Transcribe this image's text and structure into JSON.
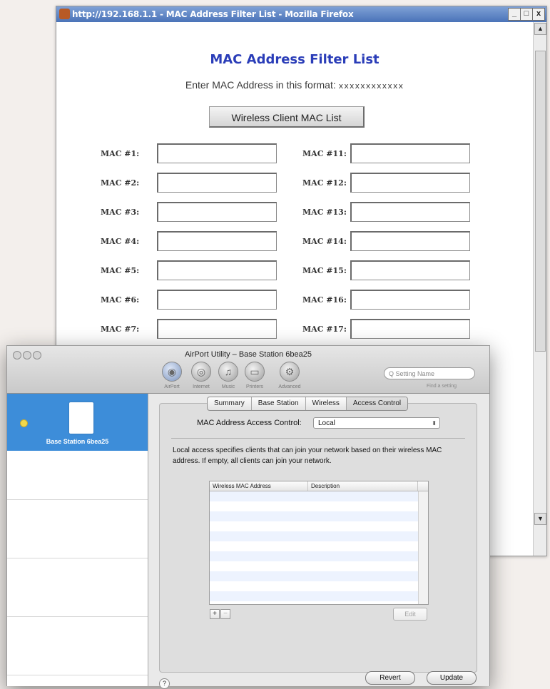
{
  "firefox": {
    "title": "http://192.168.1.1 - MAC Address Filter List - Mozilla Firefox",
    "win_buttons": [
      "_",
      "□",
      "x"
    ],
    "page_title": "MAC Address Filter List",
    "format_label": "Enter MAC Address in this format:",
    "format_value": "xxxxxxxxxxxx",
    "wireless_button": "Wireless Client MAC List",
    "mac_left": [
      "MAC #1:",
      "MAC #2:",
      "MAC #3:",
      "MAC #4:",
      "MAC #5:",
      "MAC #6:",
      "MAC #7:"
    ],
    "mac_right": [
      "MAC #11:",
      "MAC #12:",
      "MAC #13:",
      "MAC #14:",
      "MAC #15:",
      "MAC #16:",
      "MAC #17:"
    ],
    "scroll_up": "▲",
    "scroll_down": "▼"
  },
  "airport": {
    "title": "AirPort Utility – Base Station 6bea25",
    "toolbar": {
      "airport": "AirPort",
      "internet": "Internet",
      "music": "Music",
      "printers": "Printers",
      "advanced": "Advanced"
    },
    "search_placeholder": "Q Setting Name",
    "search_hint": "Find a setting",
    "sidebar_item": "Base Station 6bea25",
    "tabs": [
      "Summary",
      "Base Station",
      "Wireless",
      "Access Control"
    ],
    "mac_access_label": "MAC Address Access Control:",
    "mac_access_value": "Local",
    "description": "Local access specifies clients that can join your network based on their wireless MAC address. If empty, all clients can join your network.",
    "table_headers": [
      "Wireless MAC Address",
      "Description"
    ],
    "add_label": "+",
    "remove_label": "−",
    "edit_label": "Edit",
    "help_label": "?",
    "revert_label": "Revert",
    "update_label": "Update"
  }
}
